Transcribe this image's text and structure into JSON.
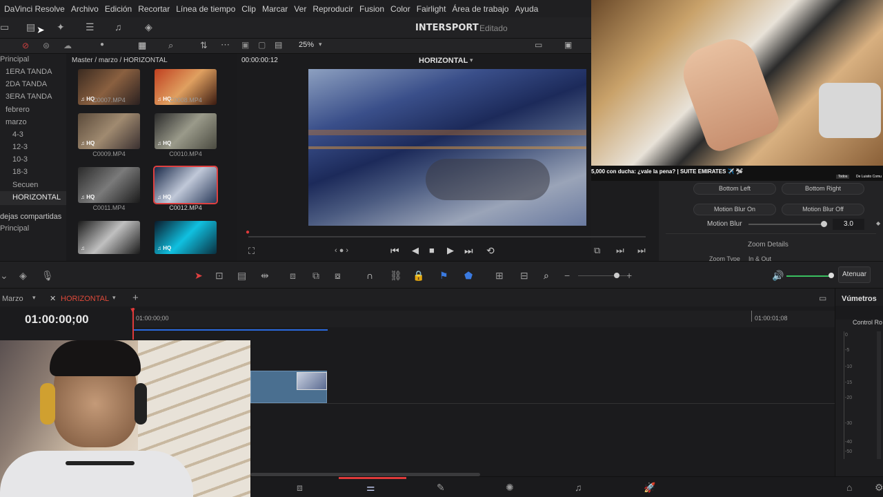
{
  "menu": [
    "DaVinci Resolve",
    "Archivo",
    "Edición",
    "Recortar",
    "Línea de tiempo",
    "Clip",
    "Marcar",
    "Ver",
    "Reproducir",
    "Fusion",
    "Color",
    "Fairlight",
    "Área de trabajo",
    "Ayuda"
  ],
  "project": {
    "name": "INTERSPORT",
    "status": "Editado"
  },
  "viewer": {
    "zoom": "25%",
    "timecode": "00:00:00:12",
    "timeline_name": "HORIZONTAL"
  },
  "breadcrumb": "Master / marzo / HORIZONTAL",
  "bins": [
    "Principal",
    "1ERA TANDA",
    "2DA TANDA",
    "3ERA TANDA",
    "febrero",
    "marzo",
    "4-3",
    "12-3",
    "10-3",
    "18-3",
    "Secuen",
    "HORIZONTAL",
    "Bandejas compartidas",
    "Principal"
  ],
  "bins_display": [
    "Principal",
    "1ERA TANDA",
    "2DA TANDA",
    "3ERA TANDA",
    "febrero",
    "marzo",
    "4-3",
    "12-3",
    "10-3",
    "18-3",
    "Secuen",
    "HORIZONTAL",
    "dejas compartidas",
    "Principal"
  ],
  "clips": [
    "C0007.MP4",
    "C0008.MP4",
    "C0009.MP4",
    "C0010.MP4",
    "C0011.MP4",
    "C0012.MP4"
  ],
  "badge": "HQ",
  "inspector": {
    "bottom_left": "Bottom Left",
    "bottom_right": "Bottom Right",
    "mb_on": "Motion Blur On",
    "mb_off": "Motion Blur Off",
    "mb_label": "Motion Blur",
    "mb_value": "3.0",
    "zoom_details": "Zoom Details",
    "zoom_type": "Zoom Type",
    "zoom_type_val": "In & Out"
  },
  "youtube_title": "5,000 con ducha: ¿vale la pena? | SUITE EMIRATES ✈️ 🛩",
  "youtube_chip": "Todos",
  "youtube_channel": "De Luisito Comu",
  "timeline": {
    "folder": "Marzo",
    "tab": "HORIZONTAL",
    "timecode": "01:00:00;00",
    "ruler_start": "01:00:00;00",
    "ruler_end": "01:00:01;08",
    "attenuate": "Atenuar"
  },
  "vumeter": {
    "title": "Vúmetros",
    "control": "Control Ro",
    "scale": [
      "0",
      "-5",
      "-10",
      "-15",
      "-20",
      "-30",
      "-40",
      "-50"
    ]
  }
}
